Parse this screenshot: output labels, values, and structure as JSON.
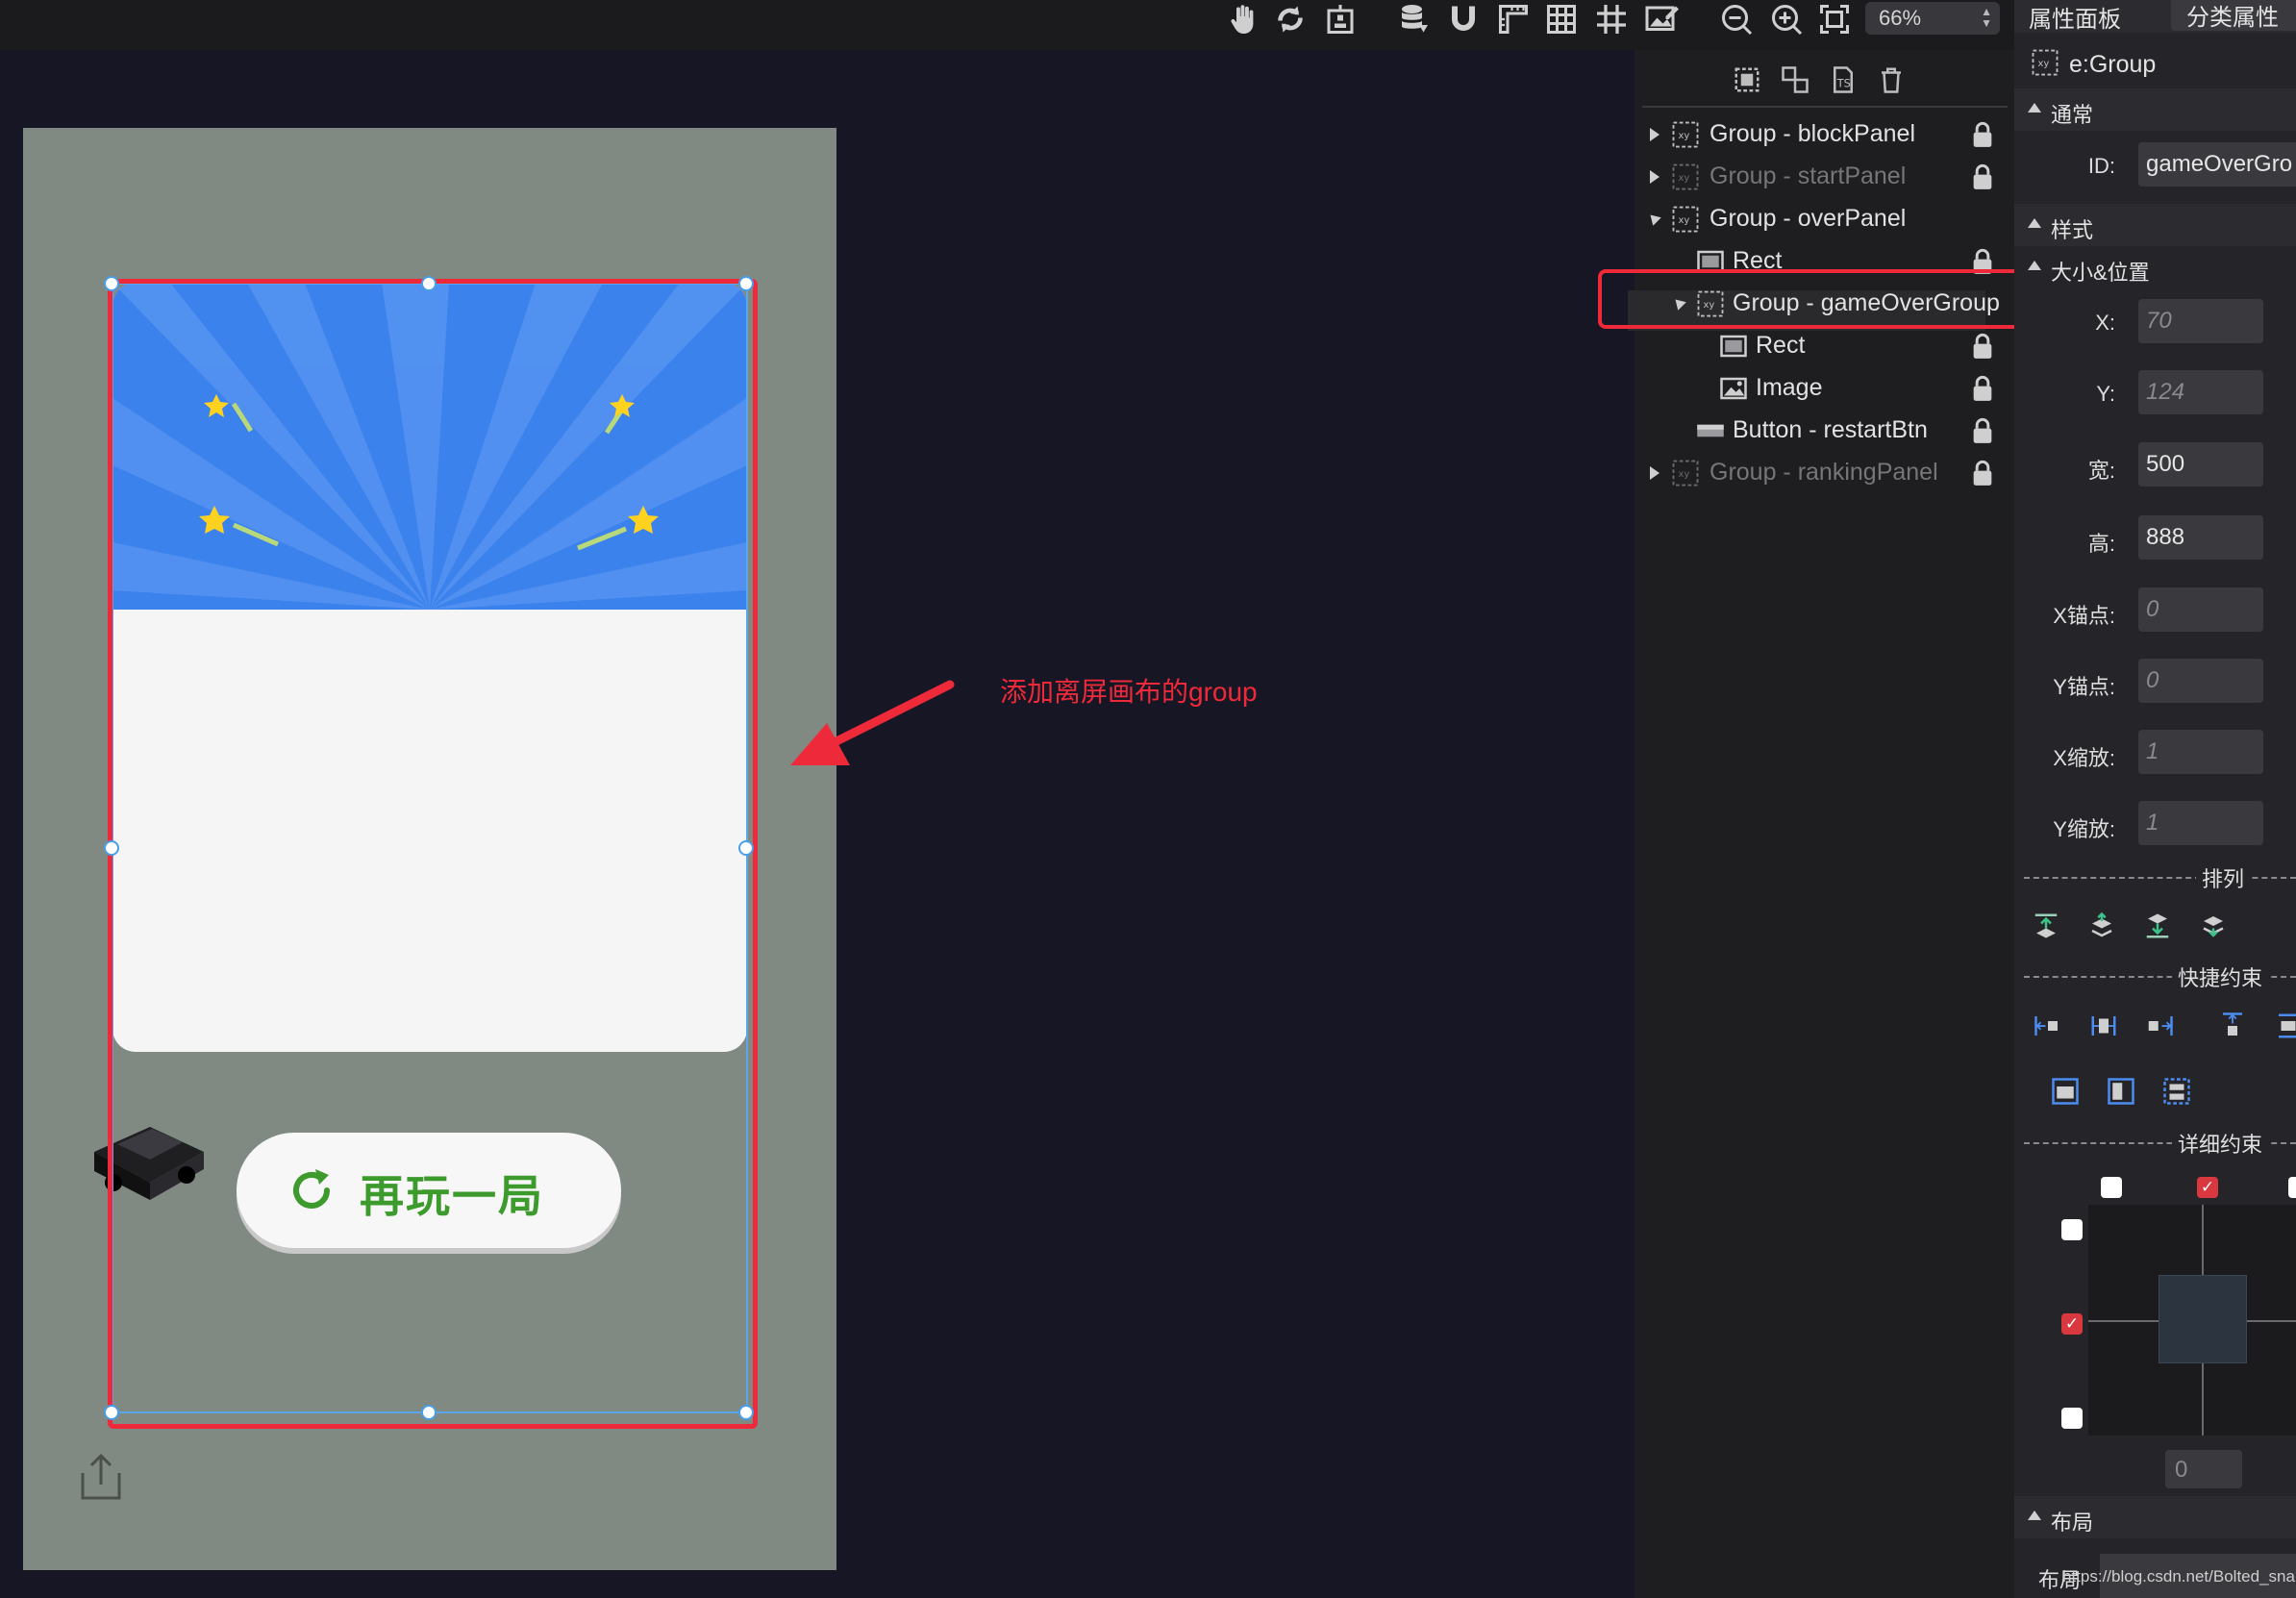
{
  "toolbar": {
    "icons": [
      "hand-icon",
      "refresh-icon",
      "anchor-box-icon",
      "database-icon",
      "magnet-icon",
      "ruler-icon",
      "grid-icon",
      "hash-grid-icon",
      "image-edit-icon",
      "zoom-out-icon",
      "zoom-in-icon",
      "fit-screen-icon"
    ],
    "zoom_value": "66%"
  },
  "stage": {
    "restart_button_label": "再玩一局",
    "annotation_text": "添加离屏画布的group"
  },
  "layers": {
    "items": [
      {
        "label": "Group - blockPanel",
        "dim": false,
        "locked": true
      },
      {
        "label": "Group - startPanel",
        "dim": true,
        "locked": true
      },
      {
        "label": "Group - overPanel",
        "dim": false,
        "locked": false
      },
      {
        "label": "Rect",
        "dim": false,
        "locked": true
      },
      {
        "label": "Group - gameOverGroup",
        "dim": false,
        "locked": false,
        "selected": true
      },
      {
        "label": "Rect",
        "dim": false,
        "locked": true
      },
      {
        "label": "Image",
        "dim": false,
        "locked": true
      },
      {
        "label": "Button - restartBtn",
        "dim": false,
        "locked": true
      },
      {
        "label": "Group - rankingPanel",
        "dim": true,
        "locked": true
      }
    ]
  },
  "props": {
    "tab_active": "属性面板",
    "tab_other": "分类属性",
    "element_type": "e:Group",
    "section_general": "通常",
    "id_label": "ID:",
    "id_value": "gameOverGro",
    "section_style": "样式",
    "section_size": "大小&位置",
    "x_label": "X:",
    "x_value": "70",
    "y_label": "Y:",
    "y_value": "124",
    "w_label": "宽:",
    "w_value": "500",
    "h_label": "高:",
    "h_value": "888",
    "ax_label": "X锚点:",
    "ax_value": "0",
    "ay_label": "Y锚点:",
    "ay_value": "0",
    "sx_label": "X缩放:",
    "sx_value": "1",
    "sy_label": "Y缩放:",
    "sy_value": "1",
    "arrange_title": "排列",
    "quick_title": "快捷约束",
    "detail_title": "详细约束",
    "constraint_value": "0",
    "section_layout": "布局",
    "layout_label": "布局"
  },
  "watermark": "https://blog.csdn.net/Bolted_snail"
}
